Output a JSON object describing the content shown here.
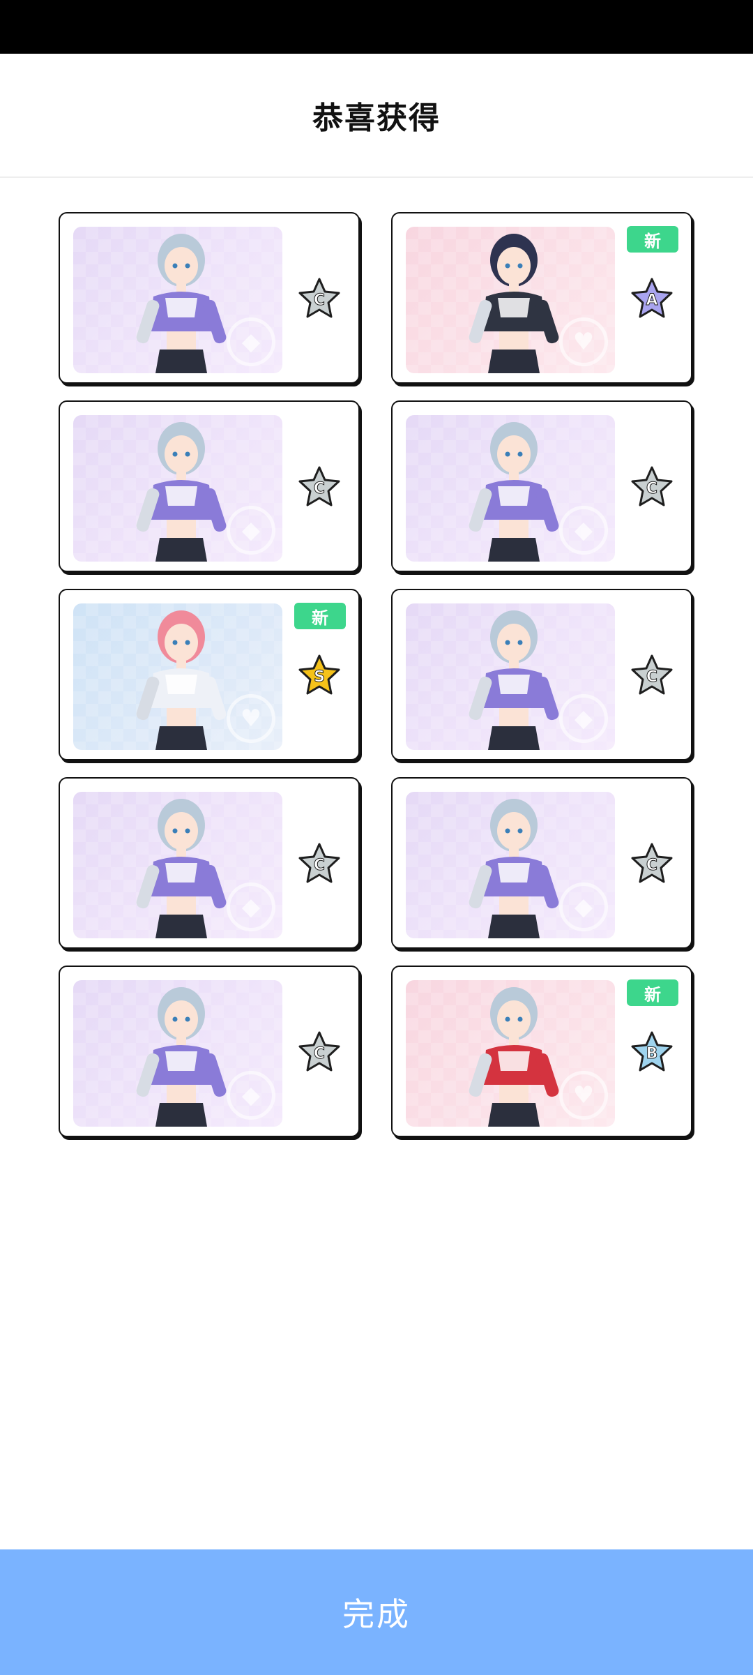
{
  "header": {
    "title": "恭喜获得"
  },
  "cards": [
    {
      "rarity": "C",
      "is_new": false,
      "bg": "purple",
      "outfit": "purple"
    },
    {
      "rarity": "A",
      "is_new": true,
      "bg": "pink",
      "outfit": "dark"
    },
    {
      "rarity": "C",
      "is_new": false,
      "bg": "purple",
      "outfit": "purple"
    },
    {
      "rarity": "C",
      "is_new": false,
      "bg": "purple",
      "outfit": "purple"
    },
    {
      "rarity": "S",
      "is_new": true,
      "bg": "blue",
      "outfit": "white"
    },
    {
      "rarity": "C",
      "is_new": false,
      "bg": "purple",
      "outfit": "purple"
    },
    {
      "rarity": "C",
      "is_new": false,
      "bg": "purple",
      "outfit": "purple"
    },
    {
      "rarity": "C",
      "is_new": false,
      "bg": "purple",
      "outfit": "purple"
    },
    {
      "rarity": "C",
      "is_new": false,
      "bg": "purple",
      "outfit": "purple"
    },
    {
      "rarity": "B",
      "is_new": true,
      "bg": "pink",
      "outfit": "red"
    }
  ],
  "new_badge_label": "新",
  "rarity_colors": {
    "C": "#c9d0d1",
    "B": "#9fd4ee",
    "A": "#a9a4ef",
    "S": "#f5c21a"
  },
  "outfit_colors": {
    "purple": "#8a7bd8",
    "dark": "#2f3442",
    "white": "#eef1f7",
    "red": "#d4333f"
  },
  "hair_colors": {
    "purple": "#b9cad9",
    "dark": "#2e3350",
    "white": "#f08a9a",
    "red": "#b9cad9"
  },
  "emblem_icons": [
    "diamond-icon",
    "heart-icon"
  ],
  "footer": {
    "done_label": "完成"
  }
}
